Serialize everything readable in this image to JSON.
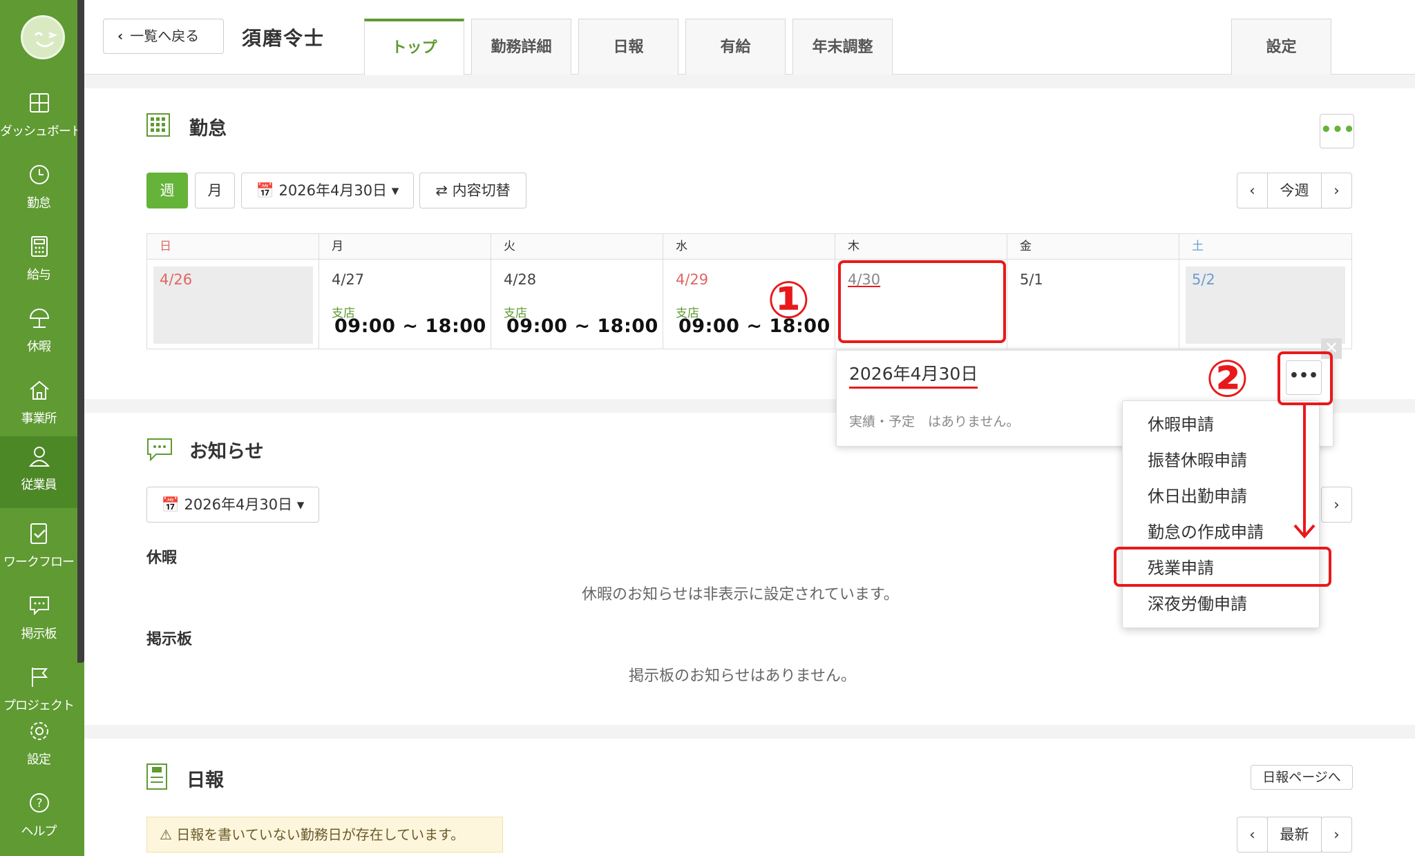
{
  "sidebar": {
    "items": [
      {
        "label": "ダッシュボード",
        "icon": "dashboard-icon"
      },
      {
        "label": "勤怠",
        "icon": "clock-icon"
      },
      {
        "label": "給与",
        "icon": "calculator-icon"
      },
      {
        "label": "休暇",
        "icon": "umbrella-icon"
      },
      {
        "label": "事業所",
        "icon": "home-icon"
      },
      {
        "label": "従業員",
        "icon": "user-icon"
      },
      {
        "label": "ワークフロー",
        "icon": "checklist-icon"
      },
      {
        "label": "掲示板",
        "icon": "chat-icon"
      },
      {
        "label": "プロジェクト",
        "icon": "flag-icon"
      }
    ],
    "settings": "設定",
    "help": "ヘルプ"
  },
  "header": {
    "back_label": "一覧へ戻る",
    "employee_name": "須磨令士",
    "tabs": [
      "トップ",
      "勤務詳細",
      "日報",
      "有給",
      "年末調整"
    ],
    "settings_tab": "設定"
  },
  "attendance": {
    "title": "勤怠",
    "week_btn": "週",
    "month_btn": "月",
    "date_select": "2026年4月30日",
    "toggle_btn": "内容切替",
    "nav_today": "今週",
    "days": [
      {
        "head": "日",
        "date": "4/26",
        "loc": "",
        "time": ""
      },
      {
        "head": "月",
        "date": "4/27",
        "loc": "支店",
        "time": "09:00 ~ 18:00"
      },
      {
        "head": "火",
        "date": "4/28",
        "loc": "支店",
        "time": "09:00 ~ 18:00"
      },
      {
        "head": "水",
        "date": "4/29",
        "loc": "支店",
        "time": "09:00 ~ 18:00"
      },
      {
        "head": "木",
        "date": "4/30",
        "loc": "",
        "time": ""
      },
      {
        "head": "金",
        "date": "5/1",
        "loc": "",
        "time": ""
      },
      {
        "head": "土",
        "date": "5/2",
        "loc": "",
        "time": ""
      }
    ]
  },
  "popover": {
    "date": "2026年4月30日",
    "message": "実績・予定　はありません。"
  },
  "menu": {
    "items": [
      "休暇申請",
      "振替休暇申請",
      "休日出勤申請",
      "勤怠の作成申請",
      "残業申請",
      "深夜労働申請"
    ]
  },
  "annotations": {
    "step1": "①",
    "step2": "②"
  },
  "news": {
    "title": "お知らせ",
    "date_select": "2026年4月30日",
    "leave_heading": "休暇",
    "leave_msg": "休暇のお知らせは非表示に設定されています。",
    "board_heading": "掲示板",
    "board_msg": "掲示板のお知らせはありません。"
  },
  "daily": {
    "title": "日報",
    "page_btn": "日報ページへ",
    "warning": "日報を書いていない勤務日が存在しています。",
    "latest_btn": "最新"
  },
  "colors": {
    "brand_green": "#5f9a32",
    "accent_red": "#e8191b",
    "sunday": "#e06666",
    "saturday": "#6b9bd1"
  }
}
